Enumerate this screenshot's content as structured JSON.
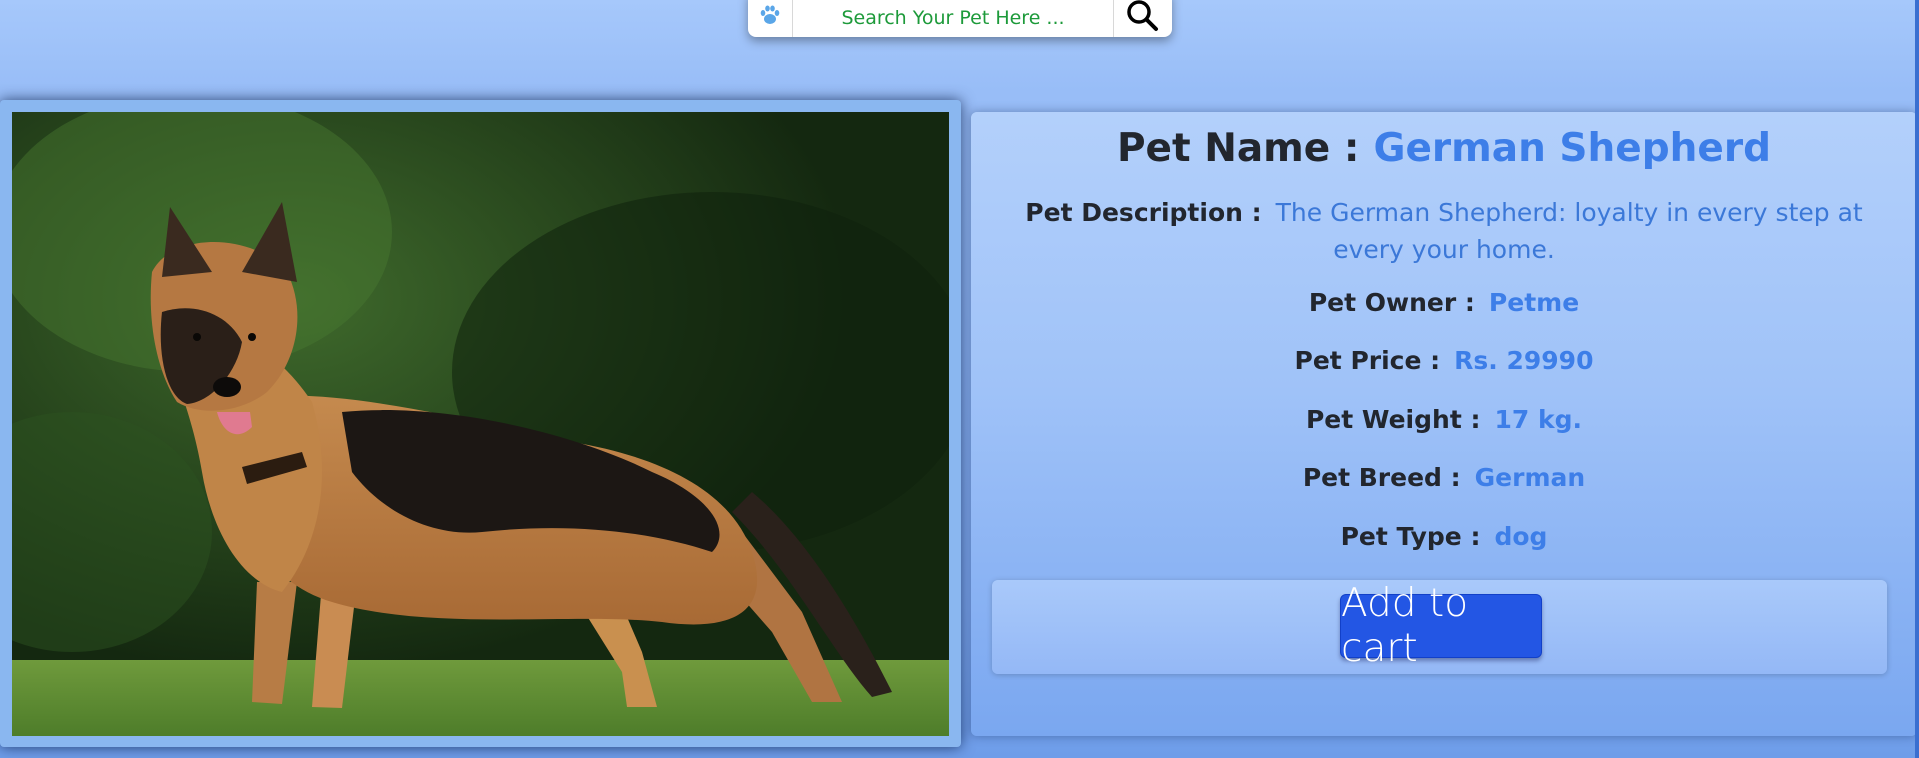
{
  "search": {
    "placeholder": "Search Your Pet Here ..."
  },
  "icons": {
    "paw": "paw-icon",
    "search": "search-icon"
  },
  "pet": {
    "name_label": "Pet Name :",
    "name": "German Shepherd",
    "description_label": "Pet Description :",
    "description": "The German Shepherd: loyalty in every step at every your home.",
    "owner_label": "Pet Owner :",
    "owner": "Petme",
    "price_label": "Pet Price :",
    "price": "Rs. 29990",
    "weight_label": "Pet Weight :",
    "weight": "17 kg.",
    "breed_label": "Pet Breed :",
    "breed": "German",
    "type_label": "Pet Type :",
    "type": "dog"
  },
  "cart": {
    "button_label": "Add to cart"
  },
  "colors": {
    "accent": "#3d7ee8",
    "button": "#2356e4",
    "search_text": "#1d9a3a",
    "paw": "#5aa6e8"
  }
}
